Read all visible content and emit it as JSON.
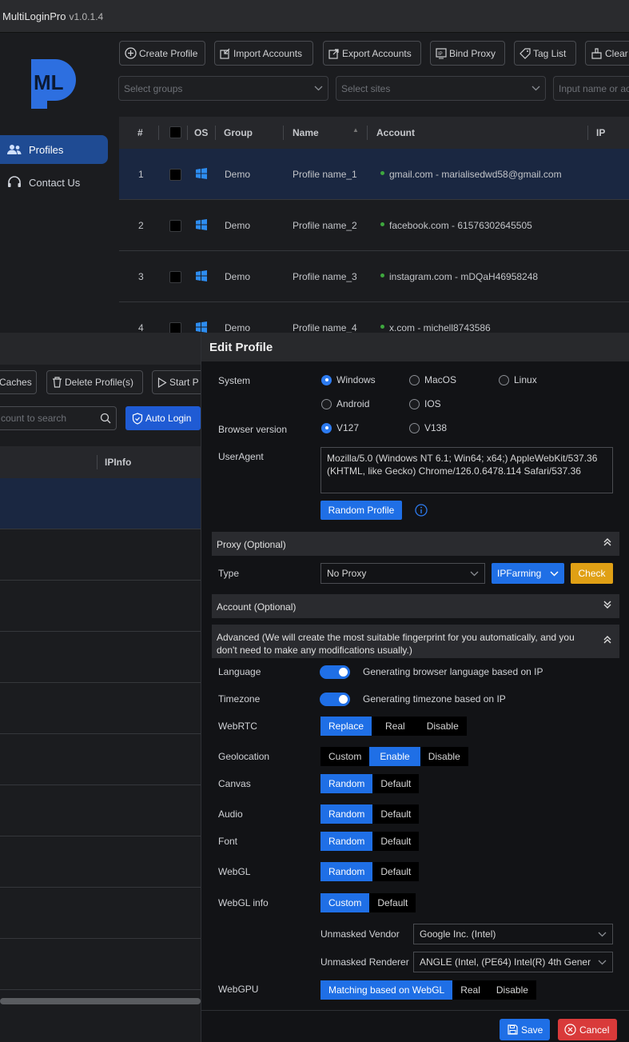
{
  "app": {
    "title": "MultiLoginPro",
    "version": "v1.0.1.4",
    "logo_text": "ML"
  },
  "nav": {
    "items": [
      {
        "label": "Profiles",
        "icon": "users-icon"
      },
      {
        "label": "Contact Us",
        "icon": "headset-icon"
      }
    ]
  },
  "toolbar": {
    "create_profile": "Create Profile",
    "import_accounts": "Import Accounts",
    "export_accounts": "Export Accounts",
    "bind_proxy": "Bind Proxy",
    "tag_list": "Tag List",
    "clear": "Clear"
  },
  "filters": {
    "groups_placeholder": "Select groups",
    "sites_placeholder": "Select sites",
    "search_placeholder": "Input name or ac"
  },
  "table": {
    "headers": {
      "num": "#",
      "os": "OS",
      "group": "Group",
      "name": "Name",
      "account": "Account",
      "ip": "IP"
    },
    "rows": [
      {
        "num": "1",
        "group": "Demo",
        "name": "Profile name_1",
        "account": "gmail.com - marialisedwd58@gmail.com"
      },
      {
        "num": "2",
        "group": "Demo",
        "name": "Profile name_2",
        "account": "facebook.com - 61576302645505"
      },
      {
        "num": "3",
        "group": "Demo",
        "name": "Profile name_3",
        "account": "instagram.com - mDQaH46958248"
      },
      {
        "num": "4",
        "group": "Demo",
        "name": "Profile name_4",
        "account": "x.com - michell8743586"
      }
    ]
  },
  "second_window": {
    "caches": "Caches",
    "delete_profiles": "Delete Profile(s)",
    "start": "Start P",
    "search_placeholder": "count to search",
    "auto_login": "Auto Login",
    "ipinfo_header": "IPInfo"
  },
  "dialog": {
    "title": "Edit Profile",
    "system_label": "System",
    "os_options": [
      "Windows",
      "MacOS",
      "Linux",
      "Android",
      "IOS"
    ],
    "os_selected": "Windows",
    "browser_version_label": "Browser version",
    "browser_versions": [
      "V127",
      "V138"
    ],
    "browser_selected": "V127",
    "useragent_label": "UserAgent",
    "useragent_value": "Mozilla/5.0 (Windows NT 6.1; Win64; x64;) AppleWebKit/537.36 (KHTML, like Gecko) Chrome/126.0.6478.114 Safari/537.36",
    "random_profile": "Random Profile",
    "proxy_section": "Proxy (Optional)",
    "type_label": "Type",
    "proxy_type_value": "No Proxy",
    "ipfarming": "IPFarming",
    "check": "Check",
    "account_section": "Account (Optional)",
    "advanced_section": "Advanced (We will create the most suitable fingerprint for you automatically, and you don't need to make any modifications usually.)",
    "language_label": "Language",
    "language_desc": "Generating browser language based on IP",
    "timezone_label": "Timezone",
    "timezone_desc": "Generating timezone based on IP",
    "webrtc_label": "WebRTC",
    "webrtc_options": [
      "Replace",
      "Real",
      "Disable"
    ],
    "geolocation_label": "Geolocation",
    "geolocation_options": [
      "Custom",
      "Enable",
      "Disable"
    ],
    "canvas_label": "Canvas",
    "audio_label": "Audio",
    "font_label": "Font",
    "webgl_label": "WebGL",
    "random_default": [
      "Random",
      "Default"
    ],
    "webglinfo_label": "WebGL info",
    "custom_default": [
      "Custom",
      "Default"
    ],
    "unmasked_vendor_label": "Unmasked Vendor",
    "unmasked_vendor_value": "Google Inc. (Intel)",
    "unmasked_renderer_label": "Unmasked Renderer",
    "unmasked_renderer_value": "ANGLE (Intel, (PE64) Intel(R) 4th Gener",
    "webgpu_label": "WebGPU",
    "webgpu_options": [
      "Matching based on WebGL",
      "Real",
      "Disable"
    ],
    "save": "Save",
    "cancel": "Cancel"
  },
  "colors": {
    "accent": "#1f6fe6",
    "check": "#e0a015",
    "cancel": "#d93a3a",
    "windows_icon": "#2d8cf0",
    "logo": "#2d6fe0"
  }
}
